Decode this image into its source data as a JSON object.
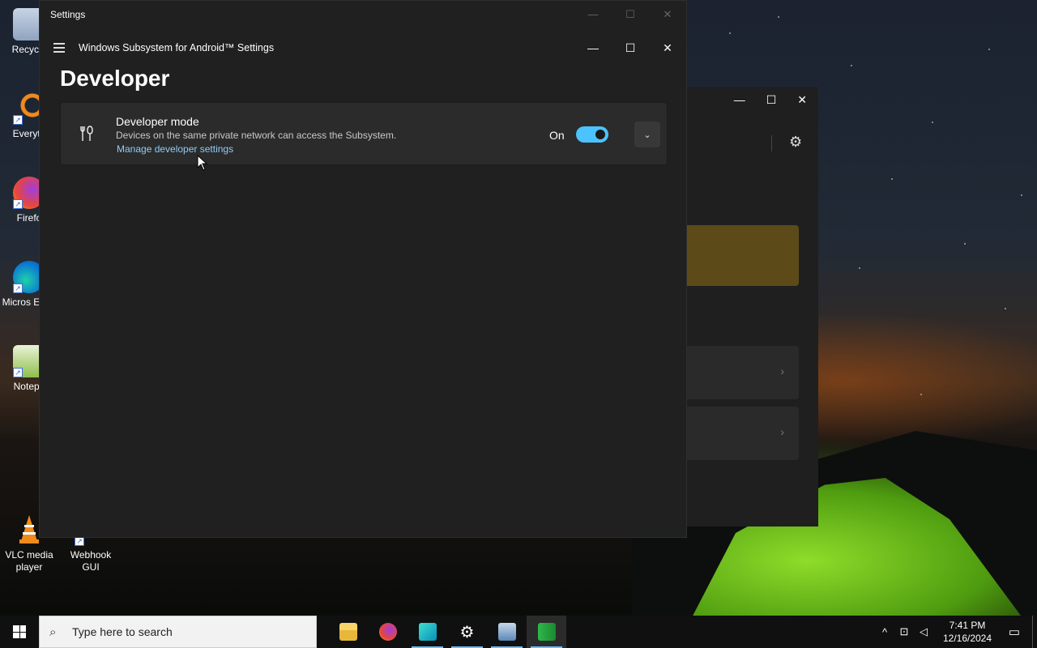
{
  "desktop": {
    "icons": [
      {
        "label": "Recycle",
        "name": "recycle-bin"
      },
      {
        "label": "Everyth",
        "name": "everything"
      },
      {
        "label": "Firefo",
        "name": "firefox"
      },
      {
        "label": "Micros Edge",
        "name": "microsoft-edge"
      },
      {
        "label": "Notepa",
        "name": "notepad"
      },
      {
        "label": "VLC media player",
        "name": "vlc"
      },
      {
        "label": "Webhook GUI",
        "name": "webhook-gui"
      }
    ]
  },
  "outer_window": {
    "title": "Settings",
    "controls": [
      "—",
      "☐",
      "✕"
    ]
  },
  "wsa_window": {
    "title": "Windows Subsystem for Android™ Settings",
    "controls": [
      "—",
      "☐",
      "✕"
    ],
    "page_title": "Developer",
    "developer_mode": {
      "title": "Developer mode",
      "description": "Devices on the same private network can access the Subsystem.",
      "link": "Manage developer settings",
      "state_label": "On",
      "enabled": true
    }
  },
  "background_window": {
    "controls": [
      "—",
      "☐",
      "✕"
    ]
  },
  "taskbar": {
    "search_placeholder": "Type here to search",
    "apps": [
      "file-explorer",
      "firefox",
      "wsa-app",
      "settings",
      "control-panel",
      "android-app"
    ],
    "time": "7:41 PM",
    "date": "12/16/2024"
  },
  "colors": {
    "accent": "#4cc2ff",
    "link": "#8ecdf8",
    "window_bg": "#202020",
    "card_bg": "#2b2b2b"
  }
}
